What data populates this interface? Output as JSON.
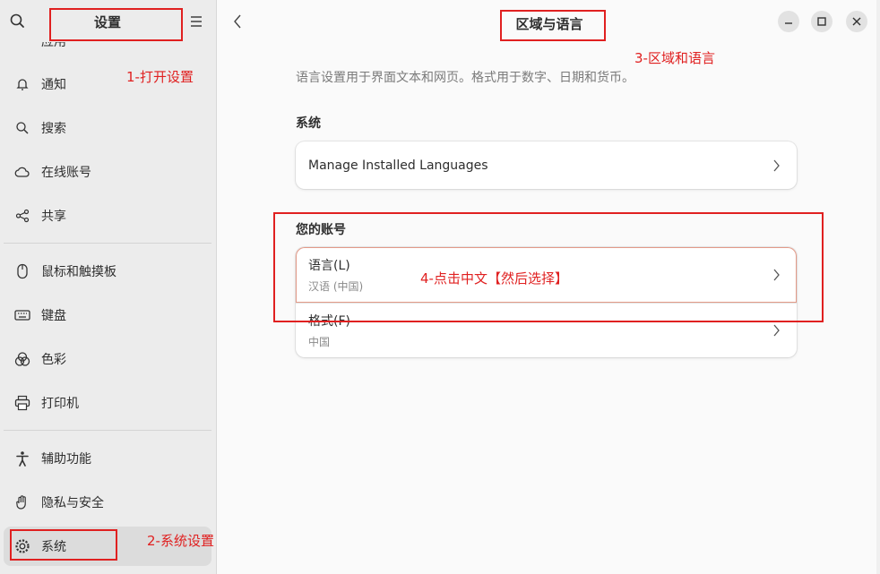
{
  "sidebar": {
    "title": "设置",
    "partial_item": "应用",
    "items": [
      {
        "label": "通知",
        "icon": "bell-icon"
      },
      {
        "label": "搜索",
        "icon": "search-icon"
      },
      {
        "label": "在线账号",
        "icon": "cloud-icon"
      },
      {
        "label": "共享",
        "icon": "share-icon"
      },
      {
        "label": "鼠标和触摸板",
        "icon": "mouse-icon"
      },
      {
        "label": "键盘",
        "icon": "keyboard-icon"
      },
      {
        "label": "色彩",
        "icon": "color-icon"
      },
      {
        "label": "打印机",
        "icon": "printer-icon"
      },
      {
        "label": "辅助功能",
        "icon": "accessibility-icon"
      },
      {
        "label": "隐私与安全",
        "icon": "hand-icon"
      },
      {
        "label": "系统",
        "icon": "gear-icon"
      }
    ]
  },
  "main": {
    "title": "区域与语言",
    "description": "语言设置用于界面文本和网页。格式用于数字、日期和货币。",
    "system_section": {
      "title": "系统",
      "row_label": "Manage Installed Languages"
    },
    "account_section": {
      "title": "您的账号",
      "language": {
        "label": "语言(L)",
        "value": "汉语 (中国)"
      },
      "format": {
        "label": "格式(F)",
        "value": "中国"
      }
    }
  },
  "annotations": {
    "step1": "1-打开设置",
    "step2": "2-系统设置",
    "step3": "3-区域和语言",
    "step4": "4-点击中文【然后选择】"
  },
  "colors": {
    "annotation": "#e02020",
    "sidebar_bg": "#ececec",
    "main_bg": "#fafafa",
    "highlight_border": "#e39a88"
  }
}
